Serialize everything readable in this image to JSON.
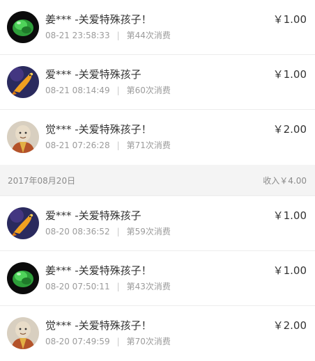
{
  "group_top": {
    "items": [
      {
        "name": "姜*** -关爱特殊孩子！",
        "time": "08-21 23:58:33",
        "count": "第44次消费",
        "amount": "￥1.00",
        "avatar": "green-jade-avatar"
      },
      {
        "name": "爱*** -关爱特殊孩子",
        "time": "08-21 08:14:49",
        "count": "第60次消费",
        "amount": "￥1.00",
        "avatar": "koi-fish-avatar"
      },
      {
        "name": "觉*** -关爱特殊孩子！",
        "time": "08-21 07:26:28",
        "count": "第71次消费",
        "amount": "￥2.00",
        "avatar": "monk-avatar"
      }
    ]
  },
  "group_0820": {
    "date": "2017年08月20日",
    "income": "收入￥4.00",
    "items": [
      {
        "name": "爱*** -关爱特殊孩子",
        "time": "08-20 08:36:52",
        "count": "第59次消费",
        "amount": "￥1.00",
        "avatar": "koi-fish-avatar"
      },
      {
        "name": "姜*** -关爱特殊孩子！",
        "time": "08-20 07:50:11",
        "count": "第43次消费",
        "amount": "￥1.00",
        "avatar": "green-jade-avatar"
      },
      {
        "name": "觉*** -关爱特殊孩子！",
        "time": "08-20 07:49:59",
        "count": "第70次消费",
        "amount": "￥2.00",
        "avatar": "monk-avatar"
      }
    ]
  },
  "separator": "|"
}
